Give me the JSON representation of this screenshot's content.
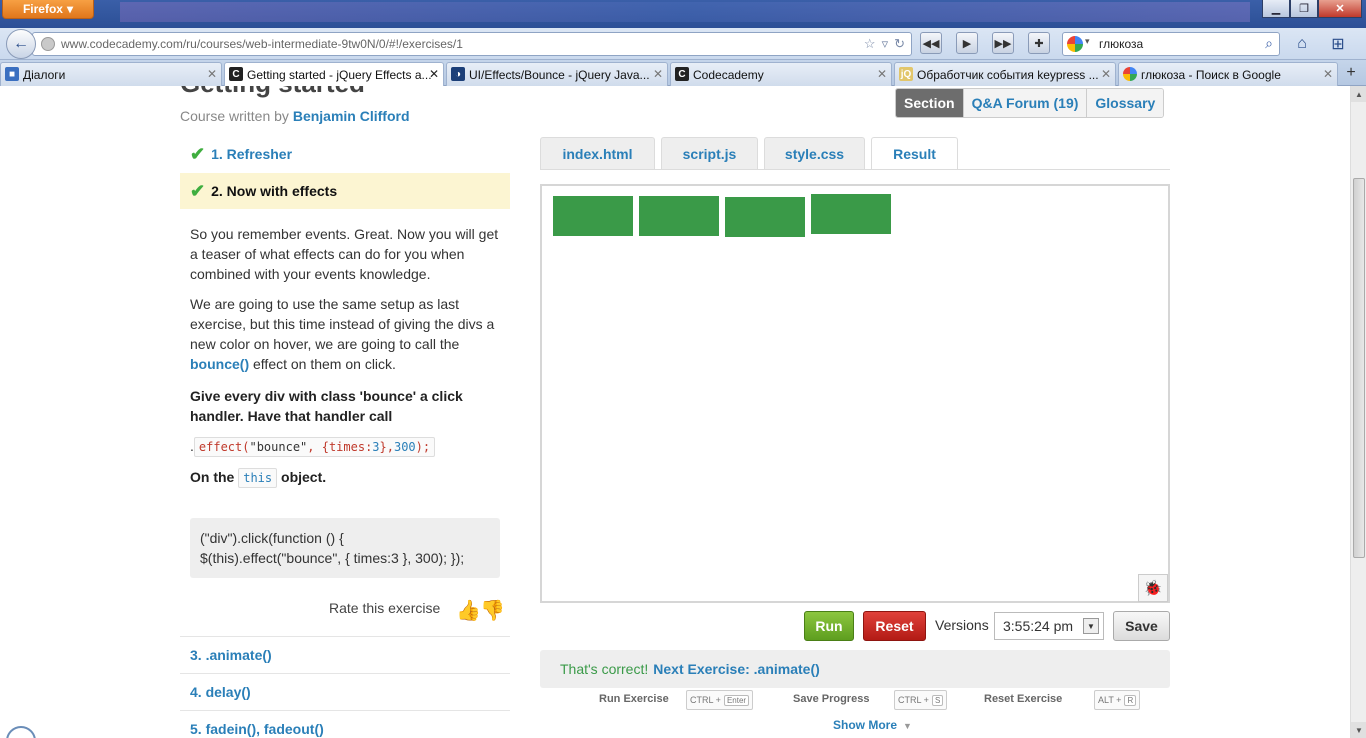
{
  "browser": {
    "menu_button": "Firefox",
    "url": "www.codecademy.com/ru/courses/web-intermediate-9tw0N/0/#!/exercises/1",
    "search_query": "глюкоза",
    "tabs": [
      {
        "title": "Діалоги",
        "icon": "dialog-icon",
        "active": false
      },
      {
        "title": "Getting started - jQuery Effects a...",
        "icon": "codecademy-icon",
        "active": true
      },
      {
        "title": "UI/Effects/Bounce - jQuery Java...",
        "icon": "jqueryui-icon",
        "active": false
      },
      {
        "title": "Codecademy",
        "icon": "codecademy-icon",
        "active": false
      },
      {
        "title": "Обработчик события keypress ...",
        "icon": "jquery-icon",
        "active": false
      },
      {
        "title": "глюкоза - Поиск в Google",
        "icon": "google-icon",
        "active": false
      }
    ]
  },
  "course": {
    "title": "Getting started",
    "written_by": "Course written by",
    "author": "Benjamin Clifford"
  },
  "section_tabs": [
    "Section",
    "Q&A Forum (19)",
    "Glossary"
  ],
  "lessons": {
    "l1": "1. Refresher",
    "l2": "2. Now with effects",
    "l3": "3. .animate()",
    "l4": "4. delay()",
    "l5": "5. fadein(), fadeout()"
  },
  "instructions": {
    "p1": "So you remember events. Great. Now you will get a teaser of what effects can do for you when combined with your events knowledge.",
    "p2_before": "We are going to use the same setup as last exercise, but this time instead of giving the divs a new color on hover, we are going to call the",
    "p2_link": "bounce()",
    "p2_after": "effect on them on click.",
    "task": "Give every div with class 'bounce' a click handler. Have that handler call",
    "code_prefix": ".",
    "code_fn": "effect(",
    "code_str": "\"bounce\"",
    "code_mid": ", {times:",
    "code_n1": "3",
    "code_mid2": "},",
    "code_n2": "300",
    "code_end": ");",
    "on_the": "On the",
    "this_kw": "this",
    "object": "object.",
    "hint_line1": "(\"div\").click(function () {",
    "hint_line2": "$(this).effect(\"bounce\", { times:3 }, 300); });",
    "rate": "Rate this exercise"
  },
  "editor_tabs": [
    "index.html",
    "script.js",
    "style.css",
    "Result"
  ],
  "controls": {
    "run": "Run",
    "reset": "Reset",
    "versions": "Versions",
    "version_value": "3:55:24 pm",
    "save": "Save"
  },
  "feedback": {
    "correct": "That's correct!",
    "next": "Next Exercise: .animate()"
  },
  "shortcuts": {
    "run": "Run Exercise",
    "run_key_mod": "CTRL +",
    "run_key": "Enter",
    "save": "Save Progress",
    "save_key_mod": "CTRL +",
    "save_key": "S",
    "reset": "Reset Exercise",
    "reset_key_mod": "ALT +",
    "reset_key": "R",
    "show_more": "Show More"
  },
  "colors": {
    "link": "#2a7fb8",
    "box_green": "#3a9a48",
    "run_green": "#6aad28",
    "reset_red": "#c9271f",
    "current_lesson_bg": "#fcf5d2"
  }
}
